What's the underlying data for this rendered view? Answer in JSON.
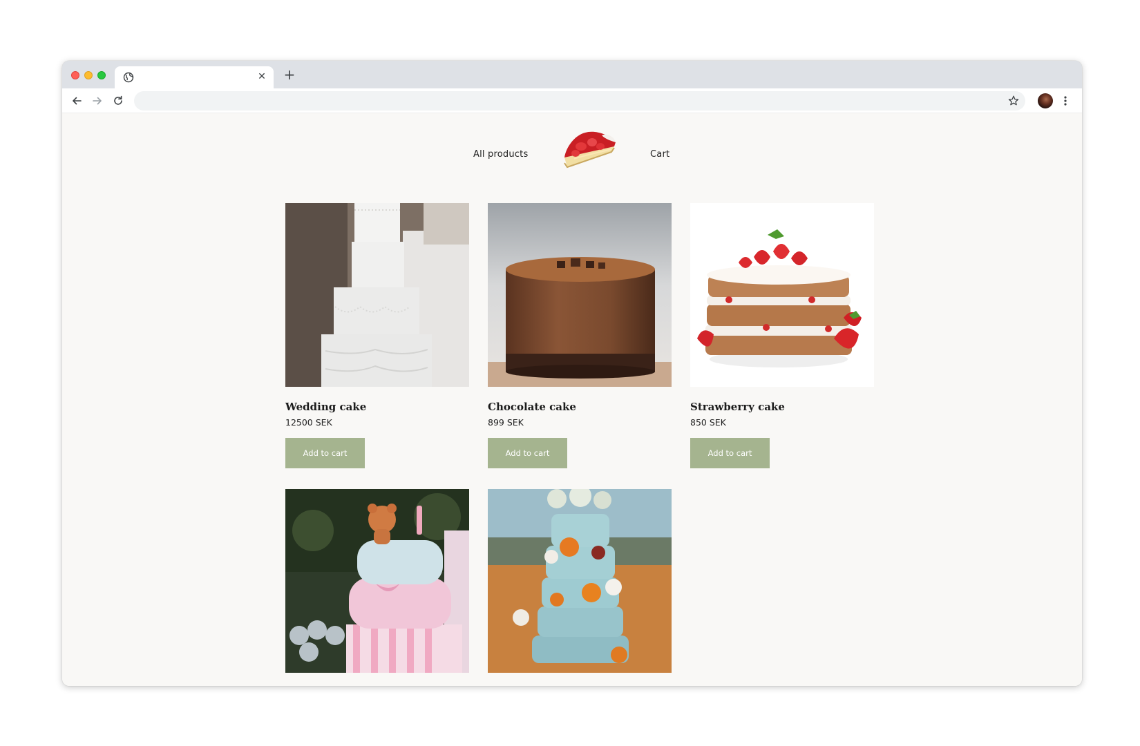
{
  "browser": {
    "tab_title": "",
    "address": ""
  },
  "nav": {
    "all_products": "All products",
    "cart": "Cart"
  },
  "products": [
    {
      "name": "Wedding cake",
      "price": "12500 SEK",
      "button": "Add to cart"
    },
    {
      "name": "Chocolate cake",
      "price": "899 SEK",
      "button": "Add to cart"
    },
    {
      "name": "Strawberry cake",
      "price": "850 SEK",
      "button": "Add to cart"
    },
    {
      "name": "",
      "price": "",
      "button": ""
    },
    {
      "name": "",
      "price": "",
      "button": ""
    }
  ],
  "colors": {
    "button_bg": "#a5b48f",
    "page_bg": "#f9f8f6"
  },
  "icons": [
    "globe-icon",
    "close-icon",
    "plus-icon",
    "back-icon",
    "forward-icon",
    "reload-icon",
    "star-icon",
    "menu-icon"
  ]
}
